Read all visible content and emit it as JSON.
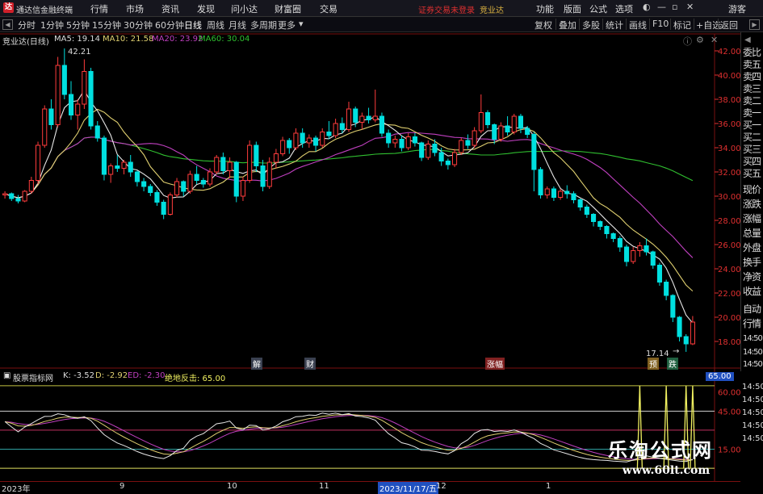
{
  "titlebar": {
    "app_title": "通达信金融终端",
    "menus": [
      "行情",
      "市场",
      "资讯",
      "发现",
      "问小达",
      "财富圈",
      "交易"
    ],
    "warning": "证券交易未登录",
    "stock_name": "竞业达",
    "right_menus": [
      "功能",
      "版面",
      "公式",
      "选项"
    ],
    "guest": "游客"
  },
  "toolbar": {
    "periods": [
      "分时",
      "1分钟",
      "5分钟",
      "15分钟",
      "30分钟",
      "60分钟",
      "日线",
      "周线",
      "月线",
      "多周期",
      "更多"
    ],
    "active_period": "日线",
    "right_buttons": [
      "复权",
      "叠加",
      "多股",
      "统计",
      "画线",
      "F10",
      "标记",
      "+自选",
      "返回"
    ]
  },
  "main_chart": {
    "stock_label": "竞业达(日线)",
    "ma5_label": "MA5: 19.14",
    "ma10_label": "MA10: 21.58",
    "ma20_label": "MA20: 23.92",
    "ma60_label": "MA60: 30.04",
    "high_annotation": "42.21",
    "low_annotation": "17.14",
    "events": [
      "解",
      "财",
      "涨幅",
      "预",
      "跌"
    ]
  },
  "side_panel": {
    "items": [
      "委比",
      "卖五",
      "卖四",
      "卖三",
      "卖二",
      "卖一",
      "买一",
      "买二",
      "买三",
      "买四",
      "买五",
      "现价",
      "涨跌",
      "涨幅",
      "总量",
      "外盘",
      "换手",
      "净资",
      "收益",
      "自动",
      "行情",
      "14:50",
      "14:50",
      "14:50"
    ]
  },
  "indicator": {
    "name": "股票指标网",
    "k_label": "K: -3.52",
    "d_label": "D: -2.92",
    "ed_label": "ED: -2.30",
    "jdft_label": "绝地反击: 65.00",
    "current_value": "65.00",
    "sub_axis_ticks": [
      "60.00",
      "45.00",
      "15.00"
    ],
    "right_times": [
      "14:50",
      "14:50",
      "14:50",
      "14:50",
      "14:50"
    ]
  },
  "date_axis": {
    "labels": [
      "2023年",
      "9",
      "10",
      "11",
      "2023/11/17/五",
      "12",
      "1"
    ]
  },
  "watermark": {
    "line1": "乐淘公式网",
    "line2": "www.60lt.com"
  },
  "colors": {
    "up": "#ff3c3c",
    "down": "#00e0e0",
    "ma5": "#e8e8e8",
    "ma10": "#e0d070",
    "ma20": "#c040c0",
    "ma60": "#30c030",
    "axis": "#e03030"
  },
  "chart_data": {
    "type": "candlestick",
    "price_axis": {
      "ylim": [
        17,
        43
      ],
      "ticks": [
        "42.00",
        "40.00",
        "38.00",
        "36.00",
        "34.00",
        "32.00",
        "30.00",
        "28.00",
        "26.00",
        "24.00",
        "22.00",
        "20.00",
        "18.00"
      ]
    },
    "candles": [
      [
        30.1,
        30.4,
        29.8,
        30.2
      ],
      [
        30.2,
        30.3,
        29.6,
        29.8
      ],
      [
        29.8,
        30.1,
        29.4,
        29.6
      ],
      [
        29.6,
        30.5,
        29.5,
        30.4
      ],
      [
        30.4,
        31.6,
        30.2,
        31.3
      ],
      [
        31.3,
        34.5,
        31.0,
        34.2
      ],
      [
        34.2,
        37.5,
        34.0,
        37.2
      ],
      [
        37.2,
        38.0,
        35.5,
        35.9
      ],
      [
        35.9,
        41.5,
        35.7,
        40.8
      ],
      [
        40.8,
        42.2,
        38.0,
        38.4
      ],
      [
        38.4,
        39.5,
        36.3,
        36.7
      ],
      [
        36.7,
        38.0,
        35.5,
        37.6
      ],
      [
        37.6,
        41.3,
        37.2,
        40.3
      ],
      [
        40.3,
        40.6,
        35.5,
        35.8
      ],
      [
        35.8,
        36.2,
        34.5,
        34.8
      ],
      [
        34.8,
        35.0,
        31.3,
        31.8
      ],
      [
        31.8,
        32.7,
        31.1,
        32.5
      ],
      [
        32.5,
        33.4,
        32.0,
        32.3
      ],
      [
        32.3,
        33.0,
        31.8,
        32.8
      ],
      [
        32.8,
        33.4,
        31.6,
        32.0
      ],
      [
        32.0,
        32.1,
        30.8,
        31.2
      ],
      [
        31.2,
        31.5,
        30.4,
        30.8
      ],
      [
        30.8,
        31.0,
        30.0,
        30.3
      ],
      [
        30.3,
        30.5,
        29.2,
        29.5
      ],
      [
        29.5,
        29.7,
        28.1,
        28.5
      ],
      [
        28.5,
        30.3,
        28.4,
        30.1
      ],
      [
        30.1,
        31.5,
        29.9,
        31.2
      ],
      [
        31.2,
        31.3,
        30.0,
        30.4
      ],
      [
        30.4,
        32.1,
        30.2,
        31.8
      ],
      [
        31.8,
        32.5,
        31.0,
        31.3
      ],
      [
        31.3,
        31.5,
        30.7,
        31.0
      ],
      [
        31.0,
        32.3,
        30.8,
        32.0
      ],
      [
        32.0,
        33.4,
        31.8,
        33.2
      ],
      [
        33.2,
        33.6,
        31.8,
        32.1
      ],
      [
        32.1,
        33.2,
        31.5,
        32.8
      ],
      [
        32.8,
        32.9,
        29.5,
        30.0
      ],
      [
        30.0,
        31.6,
        29.6,
        31.3
      ],
      [
        31.3,
        34.6,
        31.1,
        34.2
      ],
      [
        34.2,
        34.5,
        32.0,
        32.5
      ],
      [
        32.5,
        33.0,
        30.4,
        30.8
      ],
      [
        30.8,
        33.2,
        30.6,
        32.8
      ],
      [
        32.8,
        33.9,
        32.3,
        33.5
      ],
      [
        33.5,
        34.9,
        33.3,
        34.6
      ],
      [
        34.6,
        34.8,
        33.5,
        34.0
      ],
      [
        34.0,
        35.6,
        33.8,
        35.2
      ],
      [
        35.2,
        35.6,
        34.0,
        34.4
      ],
      [
        34.4,
        35.1,
        34.0,
        34.8
      ],
      [
        34.8,
        35.0,
        33.7,
        34.2
      ],
      [
        34.2,
        35.6,
        34.0,
        35.3
      ],
      [
        35.3,
        36.2,
        34.7,
        35.0
      ],
      [
        35.0,
        36.4,
        34.8,
        36.0
      ],
      [
        36.0,
        36.5,
        35.2,
        35.5
      ],
      [
        35.5,
        37.8,
        35.3,
        37.2
      ],
      [
        37.2,
        37.4,
        35.7,
        36.1
      ],
      [
        36.1,
        36.9,
        35.5,
        36.6
      ],
      [
        36.6,
        37.3,
        36.0,
        36.3
      ],
      [
        36.3,
        38.8,
        36.1,
        36.6
      ],
      [
        36.6,
        36.9,
        34.9,
        35.2
      ],
      [
        35.2,
        35.5,
        34.0,
        34.4
      ],
      [
        34.4,
        35.0,
        34.0,
        34.7
      ],
      [
        34.7,
        35.0,
        33.7,
        34.0
      ],
      [
        34.0,
        35.2,
        33.8,
        34.9
      ],
      [
        34.9,
        35.2,
        34.1,
        34.4
      ],
      [
        34.4,
        34.5,
        32.9,
        33.2
      ],
      [
        33.2,
        34.6,
        33.0,
        34.3
      ],
      [
        34.3,
        34.7,
        33.3,
        33.6
      ],
      [
        33.6,
        34.0,
        32.5,
        32.9
      ],
      [
        32.9,
        33.1,
        32.2,
        32.6
      ],
      [
        32.6,
        33.9,
        32.4,
        33.6
      ],
      [
        33.6,
        34.8,
        33.4,
        34.6
      ],
      [
        34.6,
        35.1,
        33.9,
        34.2
      ],
      [
        34.2,
        35.7,
        34.0,
        35.4
      ],
      [
        35.4,
        38.4,
        35.2,
        36.9
      ],
      [
        36.9,
        37.1,
        35.6,
        35.9
      ],
      [
        35.9,
        36.0,
        34.3,
        34.7
      ],
      [
        34.7,
        36.1,
        34.5,
        35.8
      ],
      [
        35.8,
        36.6,
        35.0,
        35.3
      ],
      [
        35.3,
        36.8,
        35.1,
        36.6
      ],
      [
        36.6,
        36.8,
        35.2,
        35.6
      ],
      [
        35.6,
        35.8,
        34.8,
        35.1
      ],
      [
        35.1,
        35.3,
        30.4,
        32.2
      ],
      [
        32.2,
        32.4,
        29.8,
        30.1
      ],
      [
        30.1,
        30.8,
        29.8,
        30.6
      ],
      [
        30.6,
        30.8,
        29.6,
        29.9
      ],
      [
        29.9,
        30.6,
        29.7,
        30.4
      ],
      [
        30.4,
        30.9,
        29.8,
        30.2
      ],
      [
        30.2,
        30.4,
        29.4,
        29.7
      ],
      [
        29.7,
        29.8,
        28.8,
        29.1
      ],
      [
        29.1,
        29.3,
        28.2,
        28.5
      ],
      [
        28.5,
        28.6,
        27.5,
        27.9
      ],
      [
        27.9,
        28.0,
        27.2,
        27.5
      ],
      [
        27.5,
        27.6,
        26.5,
        26.9
      ],
      [
        26.9,
        27.0,
        26.2,
        26.5
      ],
      [
        26.5,
        26.7,
        25.4,
        25.8
      ],
      [
        25.8,
        26.0,
        24.2,
        24.6
      ],
      [
        24.6,
        25.8,
        24.4,
        25.5
      ],
      [
        25.5,
        26.2,
        25.0,
        25.9
      ],
      [
        25.9,
        26.5,
        25.1,
        25.4
      ],
      [
        25.4,
        25.5,
        24.0,
        24.3
      ],
      [
        24.3,
        24.5,
        22.6,
        22.9
      ],
      [
        22.9,
        23.1,
        21.4,
        21.8
      ],
      [
        21.8,
        21.9,
        19.6,
        20.0
      ],
      [
        20.0,
        20.1,
        18.0,
        18.4
      ],
      [
        18.4,
        18.6,
        17.14,
        17.8
      ],
      [
        17.8,
        20.1,
        17.7,
        19.6
      ]
    ],
    "indicator_axis": {
      "ylim": [
        -5,
        70
      ]
    }
  }
}
